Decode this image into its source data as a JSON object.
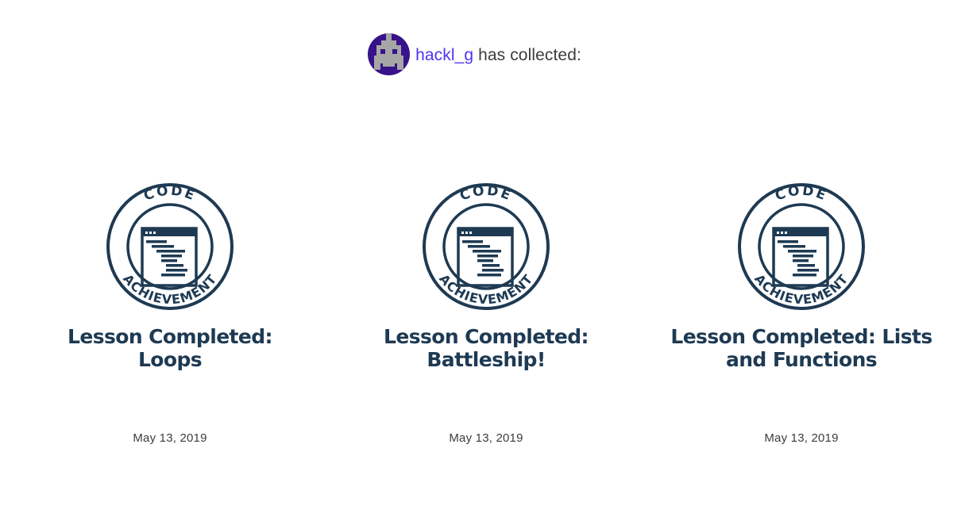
{
  "header": {
    "username": "hackl_g",
    "suffix": " has collected:"
  },
  "badge": {
    "top_text": "CODE",
    "bottom_text": "ACHIEVEMENT",
    "icon": "code-window-icon",
    "color": "#1e3a53"
  },
  "achievements": [
    {
      "title": "Lesson Completed: Loops",
      "date": "May 13, 2019"
    },
    {
      "title": "Lesson Completed: Battleship!",
      "date": "May 13, 2019"
    },
    {
      "title": "Lesson Completed: Lists and Functions",
      "date": "May 13, 2019"
    }
  ],
  "colors": {
    "avatar_bg": "#37128a",
    "username_link": "#4b35ef",
    "title_text": "#1e3a53"
  }
}
